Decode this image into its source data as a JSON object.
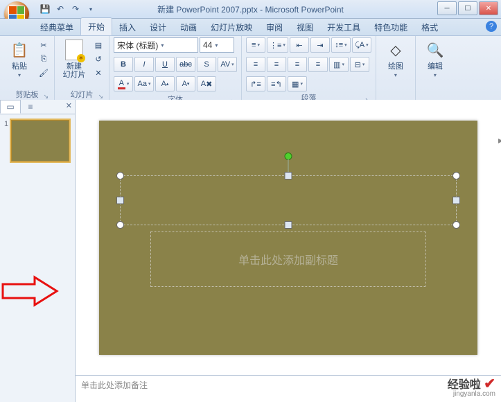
{
  "title": "新建 PowerPoint 2007.pptx - Microsoft PowerPoint",
  "tabs": [
    "经典菜单",
    "开始",
    "插入",
    "设计",
    "动画",
    "幻灯片放映",
    "审阅",
    "视图",
    "开发工具",
    "特色功能",
    "格式"
  ],
  "active_tab": "开始",
  "groups": {
    "clipboard": {
      "label": "剪贴板",
      "paste": "粘贴"
    },
    "slides": {
      "label": "幻灯片",
      "new_slide": "新建\n幻灯片"
    },
    "font": {
      "label": "字体",
      "font_name": "宋体 (标题)",
      "font_size": "44",
      "bold": "B",
      "italic": "I",
      "underline": "U",
      "abc": "abc",
      "shadow": "S",
      "av": "AV",
      "color": "A",
      "aa_big": "Aa",
      "case": "A",
      "grow": "A",
      "shrink": "A"
    },
    "paragraph": {
      "label": "段落"
    },
    "drawing": {
      "label": "绘图",
      "btn": "绘图"
    },
    "editing": {
      "label": "编辑",
      "btn": "编辑"
    }
  },
  "slide_panel": {
    "number": "1"
  },
  "slide": {
    "subtitle_placeholder": "单击此处添加副标题"
  },
  "notes_placeholder": "单击此处添加备注",
  "watermark": {
    "brand": "经验啦",
    "url": "jingyanla.com"
  }
}
